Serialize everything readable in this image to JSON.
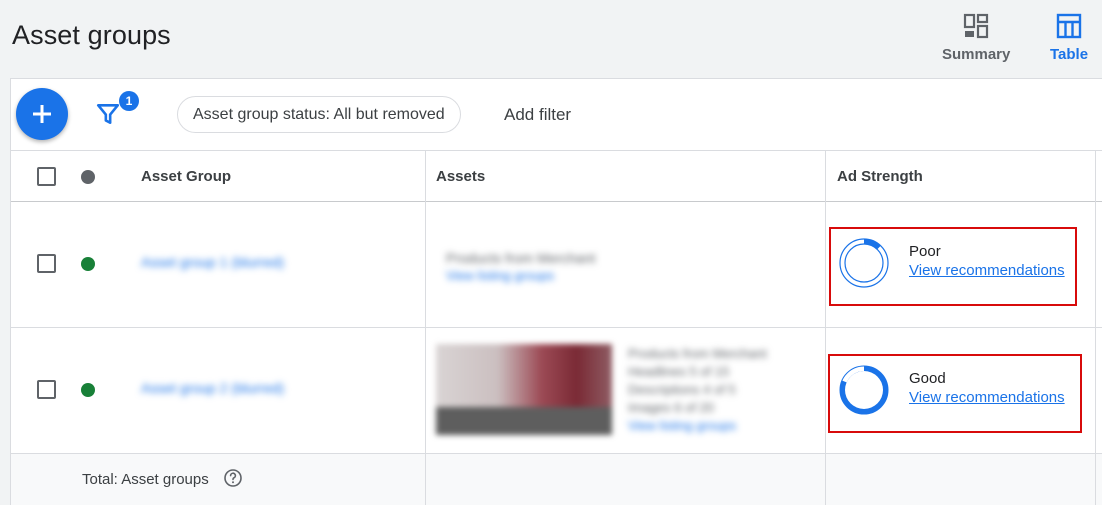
{
  "header": {
    "title": "Asset groups",
    "views": [
      {
        "label": "Summary",
        "icon": "dashboard-icon",
        "active": false
      },
      {
        "label": "Table",
        "icon": "table-icon",
        "active": true
      }
    ],
    "accent_color": "#1a73e8"
  },
  "toolbar": {
    "add_icon": "plus-icon",
    "filter_icon": "filter-icon",
    "filter_count": "1",
    "status_filter": "Asset group status: All but removed",
    "add_filter_label": "Add filter"
  },
  "table": {
    "columns": [
      "Asset Group",
      "Assets",
      "Ad Strength"
    ],
    "rows": [
      {
        "status_color": "#188038",
        "asset_group": "Asset group 1 (blurred)",
        "assets_line1": "Products from Merchant",
        "assets_line2": "View listing groups",
        "ad_strength": "Poor",
        "ad_strength_fill": 0.12,
        "recommendations": "View recommendations"
      },
      {
        "status_color": "#188038",
        "asset_group": "Asset group 2 (blurred)",
        "assets_lines": [
          "Products from Merchant",
          "Headlines     5 of 15",
          "Descriptions  4 of 5",
          "Images         6 of 20",
          "View listing groups"
        ],
        "ad_strength": "Good",
        "ad_strength_fill": 0.8,
        "recommendations": "View recommendations"
      }
    ],
    "total_label": "Total: Asset groups",
    "help_icon": "help-circle-icon"
  }
}
